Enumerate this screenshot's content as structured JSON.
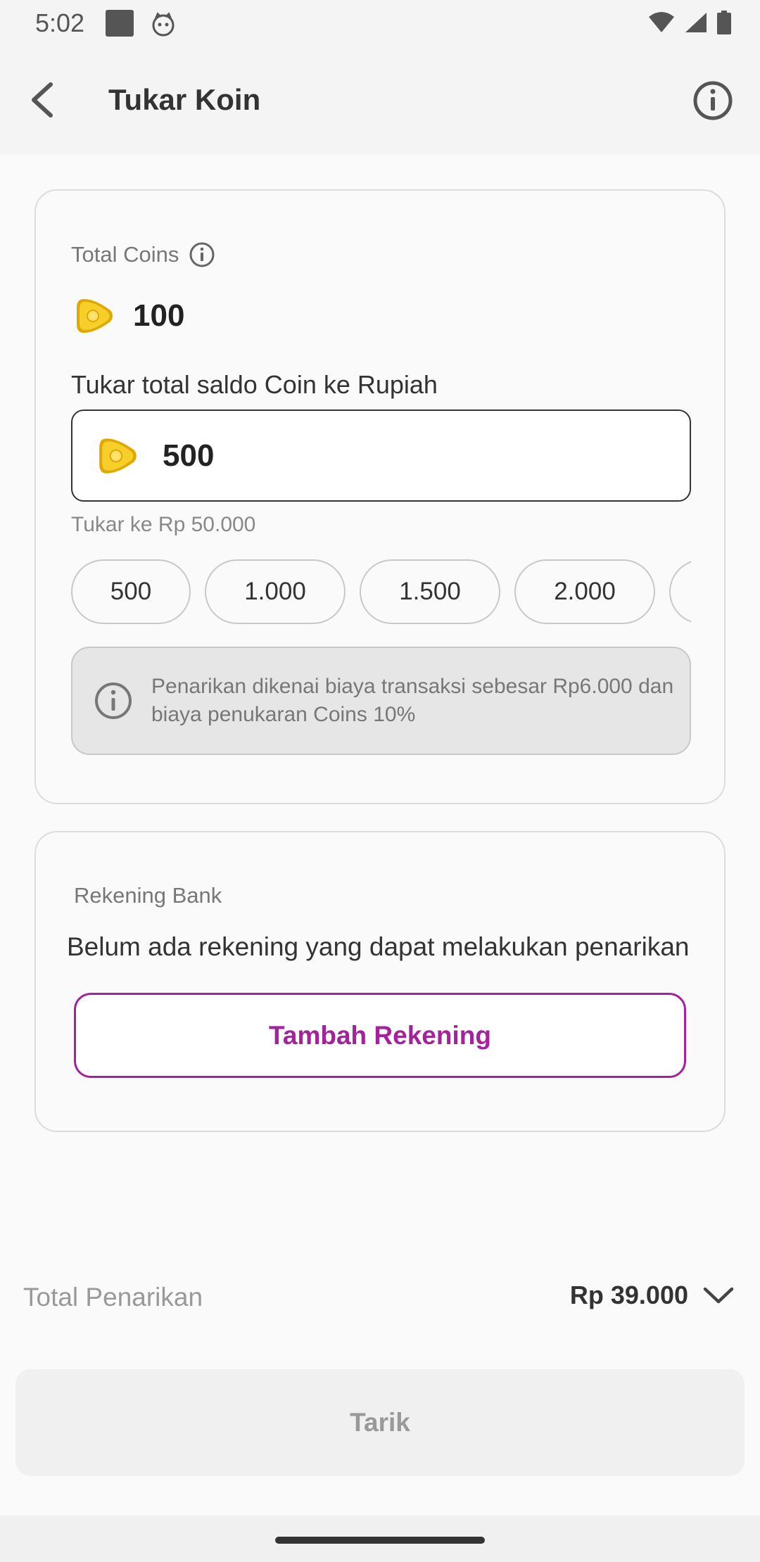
{
  "status_bar": {
    "time": "5:02",
    "icons": [
      "gallery-icon",
      "cat-icon",
      "wifi-icon",
      "signal-icon",
      "battery-icon"
    ]
  },
  "app_bar": {
    "title": "Tukar Koin",
    "back_icon": "back-arrow-icon",
    "info_icon": "info-icon"
  },
  "coins_card": {
    "total_coins_label": "Total Coins",
    "total_coins_value": "100",
    "convert_label": "Tukar total saldo Coin ke Rupiah",
    "input_value": "500",
    "convert_result": "Tukar ke Rp 50.000",
    "chips": [
      "500",
      "1.000",
      "1.500",
      "2.000"
    ],
    "notice": "Penarikan dikenai biaya transaksi sebesar Rp6.000 dan biaya penukaran Coins 10%"
  },
  "bank_card": {
    "label": "Rekening Bank",
    "empty_message": "Belum ada rekening yang dapat melakukan penarikan",
    "add_button": "Tambah Rekening"
  },
  "summary": {
    "total_label": "Total Penarikan",
    "total_value": "Rp 39.000"
  },
  "withdraw_button": "Tarik",
  "colors": {
    "accent": "#a4229b",
    "coin": "#f5c518",
    "background": "#fafafa",
    "app_bar": "#f4f4f4"
  }
}
